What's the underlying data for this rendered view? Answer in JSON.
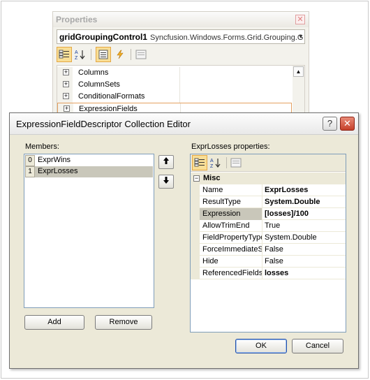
{
  "properties_window": {
    "title": "Properties",
    "close_glyph": "✕",
    "object_name": "gridGroupingControl1",
    "object_type": "Syncfusion.Windows.Forms.Grid.Grouping.G",
    "combo_arrow": "▾",
    "toolbar_icons": [
      "categorized-icon",
      "alphabetical-icon",
      "properties-icon",
      "events-icon",
      "property-pages-icon"
    ],
    "items": [
      {
        "name": "Columns"
      },
      {
        "name": "ColumnSets"
      },
      {
        "name": "ConditionalFormats"
      },
      {
        "name": "ExpressionFields"
      }
    ],
    "expand_glyph": "+",
    "scroll_up_glyph": "▲"
  },
  "dialog": {
    "title": "ExpressionFieldDescriptor Collection Editor",
    "help_glyph": "?",
    "close_glyph": "✕",
    "members_label": "Members:",
    "members": [
      {
        "index": "0",
        "name": "ExprWins"
      },
      {
        "index": "1",
        "name": "ExprLosses"
      }
    ],
    "move_up_glyph": "🡅",
    "move_down_glyph": "🡇",
    "add_label": "Add",
    "remove_label": "Remove",
    "properties_label": "ExprLosses properties:",
    "category": "Misc",
    "collapse_glyph": "−",
    "properties": [
      {
        "name": "Name",
        "value": "ExprLosses"
      },
      {
        "name": "ResultType",
        "value": "System.Double"
      },
      {
        "name": "Expression",
        "value": "[losses]/100"
      },
      {
        "name": "AllowTrimEnd",
        "value": "True"
      },
      {
        "name": "FieldPropertyType",
        "value": "System.Double"
      },
      {
        "name": "ForceImmediateSaveValue",
        "value": "False"
      },
      {
        "name": "Hide",
        "value": "False"
      },
      {
        "name": "ReferencedFields",
        "value": "losses"
      }
    ],
    "ok_label": "OK",
    "cancel_label": "Cancel"
  },
  "colors": {
    "accent_selected_toolbar": "#f8de96",
    "dialog_background": "#ece9d8",
    "close_button_red": "#c5402a",
    "selection_gray": "#c9c7ba"
  }
}
